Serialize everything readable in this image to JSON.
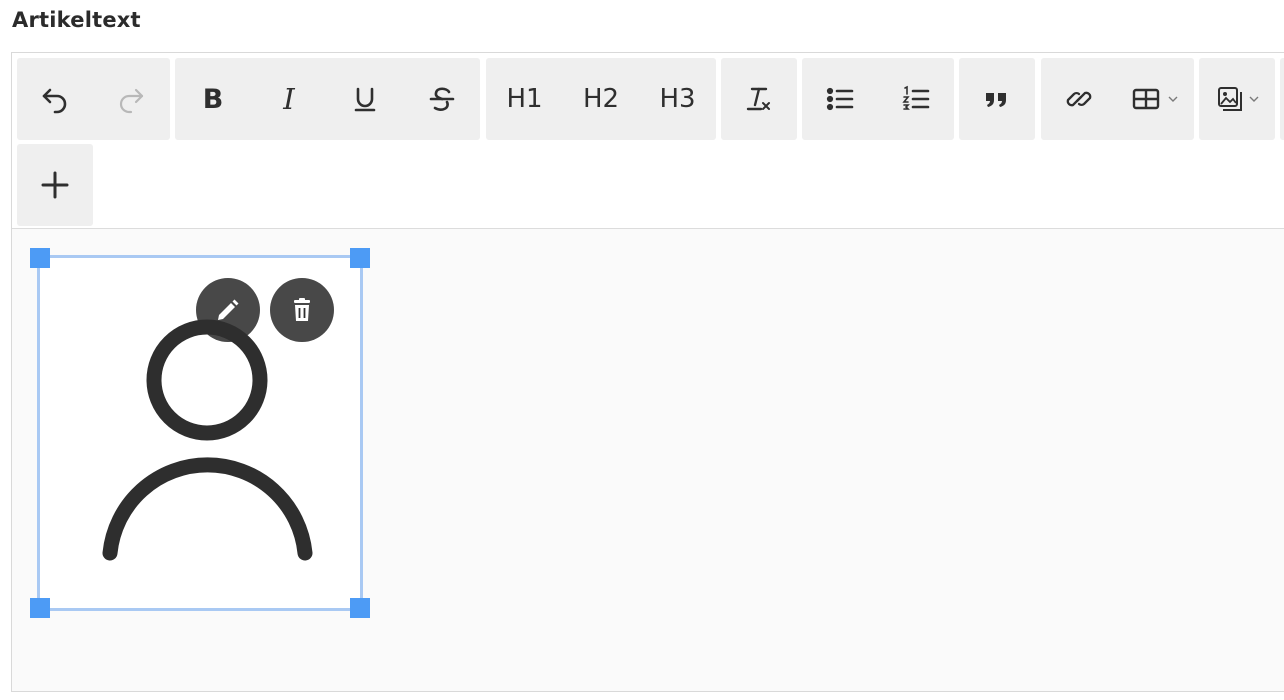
{
  "field": {
    "label": "Artikeltext"
  },
  "toolbar": {
    "undo": "undo-icon",
    "redo": "redo-icon",
    "bold": "B",
    "italic": "I",
    "underline": "underline-icon",
    "strike": "strikethrough-icon",
    "h1": "H1",
    "h2": "H2",
    "h3": "H3",
    "clear_format": "clear-format-icon",
    "bullet_list": "bulleted-list-icon",
    "numbered_list": "numbered-list-icon",
    "blockquote": "quote-icon",
    "link": "link-icon",
    "table": "table-icon",
    "image": "image-icon",
    "add": "plus-icon"
  },
  "content": {
    "image": {
      "icon": "user-avatar-icon",
      "selected": true
    },
    "image_actions": {
      "edit": "pencil-icon",
      "delete": "trash-icon"
    }
  },
  "colors": {
    "selection_outline": "#a9c9f3",
    "selection_handle": "#4d9bf5",
    "toolbar_group_bg": "#efefef",
    "action_button_bg": "#2f2f2f"
  }
}
